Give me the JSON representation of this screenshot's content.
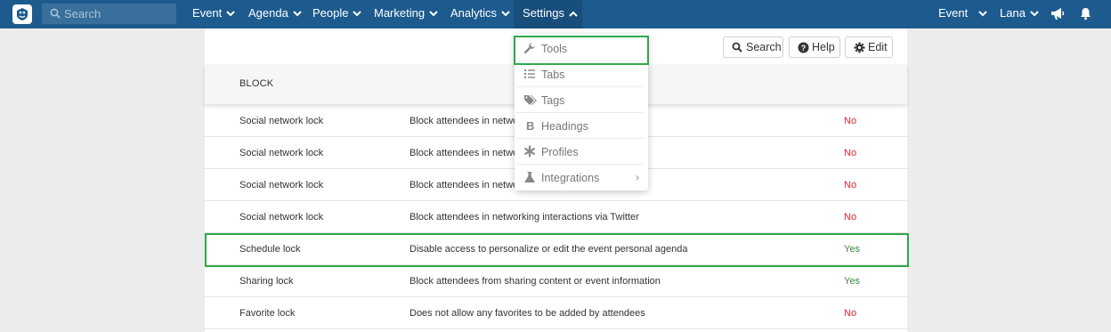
{
  "nav": {
    "search_placeholder": "Search",
    "menus": [
      {
        "label": "Event"
      },
      {
        "label": "Agenda"
      },
      {
        "label": "People"
      },
      {
        "label": "Marketing"
      },
      {
        "label": "Analytics"
      },
      {
        "label": "Settings",
        "active": true
      }
    ],
    "right": {
      "event_label": "Event",
      "user_label": "Lana",
      "icons": [
        "megaphone-icon",
        "bell-icon"
      ]
    }
  },
  "toolbar": {
    "search_label": "Search",
    "help_label": "Help",
    "edit_label": "Edit"
  },
  "table": {
    "header": "BLOCK",
    "rows": [
      {
        "name": "Social network lock",
        "description": "Block attendees in network",
        "value": "No"
      },
      {
        "name": "Social network lock",
        "description": "Block attendees in network",
        "value": "No"
      },
      {
        "name": "Social network lock",
        "description": "Block attendees in network",
        "value": "No"
      },
      {
        "name": "Social network lock",
        "description": "Block attendees in networking interactions via Twitter",
        "value": "No"
      },
      {
        "name": "Schedule lock",
        "description": "Disable access to personalize or edit the event personal agenda",
        "value": "Yes"
      },
      {
        "name": "Sharing lock",
        "description": "Block attendees from sharing content or event information",
        "value": "Yes"
      },
      {
        "name": "Favorite lock",
        "description": "Does not allow any favorites to be added by attendees",
        "value": "No"
      }
    ]
  },
  "settings_menu": {
    "items": [
      {
        "label": "Tools",
        "icon": "wrench-icon"
      },
      {
        "label": "Tabs",
        "icon": "list-icon"
      },
      {
        "label": "Tags",
        "icon": "tags-icon"
      },
      {
        "label": "Headings",
        "icon": "bold-icon"
      },
      {
        "label": "Profiles",
        "icon": "asterisk-icon"
      },
      {
        "label": "Integrations",
        "icon": "flask-icon",
        "submenu_arrow": "›"
      }
    ]
  },
  "colors": {
    "nav_bg": "#1d5b8f",
    "highlight": "#2fa84a",
    "no": "#d9272e",
    "yes": "#3a8a3a"
  }
}
